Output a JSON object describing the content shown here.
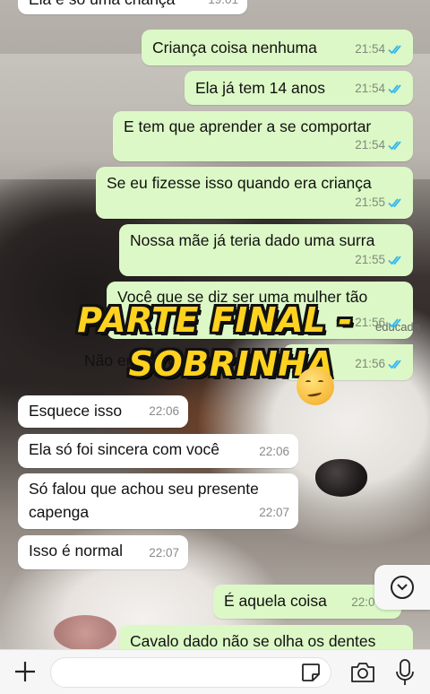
{
  "messages": [
    {
      "text": "Ela é só uma criança",
      "time": "19:01",
      "dir": "in"
    },
    {
      "text": "Criança coisa nenhuma",
      "time": "21:54",
      "dir": "out"
    },
    {
      "text": "Ela já tem 14 anos",
      "time": "21:54",
      "dir": "out"
    },
    {
      "text": "E tem que aprender a se comportar",
      "time": "21:54",
      "dir": "out"
    },
    {
      "text": "Se eu fizesse isso quando era criança",
      "time": "21:55",
      "dir": "out"
    },
    {
      "text": "Nossa mãe já teria dado uma surra",
      "time": "21:55",
      "dir": "out"
    },
    {
      "text": "Você que se diz ser uma mulher tão",
      "time": "21:56",
      "dir": "out",
      "extra": "educada"
    },
    {
      "text": "Não ensina o básico pra ela",
      "time": "21:56",
      "dir": "out"
    },
    {
      "text": "Esquece isso",
      "time": "22:06",
      "dir": "in"
    },
    {
      "text": "Ela só foi sincera com você",
      "time": "22:06",
      "dir": "in"
    },
    {
      "text": "Só falou que achou seu presente",
      "text2": "capenga",
      "time": "22:07",
      "dir": "in"
    },
    {
      "text": "Isso é normal",
      "time": "22:07",
      "dir": "in"
    },
    {
      "text": "É aquela coisa",
      "time": "22:07",
      "dir": "out"
    },
    {
      "text": "Cavalo dado não se olha os dentes",
      "time": "",
      "dir": "out"
    }
  ],
  "overlay": {
    "line1": "PARTE FINAL -",
    "line2": "SOBRINHA"
  },
  "colors": {
    "outgoing": "#dcf8c6",
    "incoming": "#ffffff",
    "ticks": "#34b7f1",
    "overlay_text": "#ffd21f"
  },
  "icons": {
    "read_receipt": "double-check-icon",
    "scroll": "chevron-down-icon",
    "attach": "plus-icon",
    "sticker": "sticker-icon",
    "camera": "camera-icon",
    "mic": "microphone-icon",
    "emoji": "melting-face-emoji"
  }
}
